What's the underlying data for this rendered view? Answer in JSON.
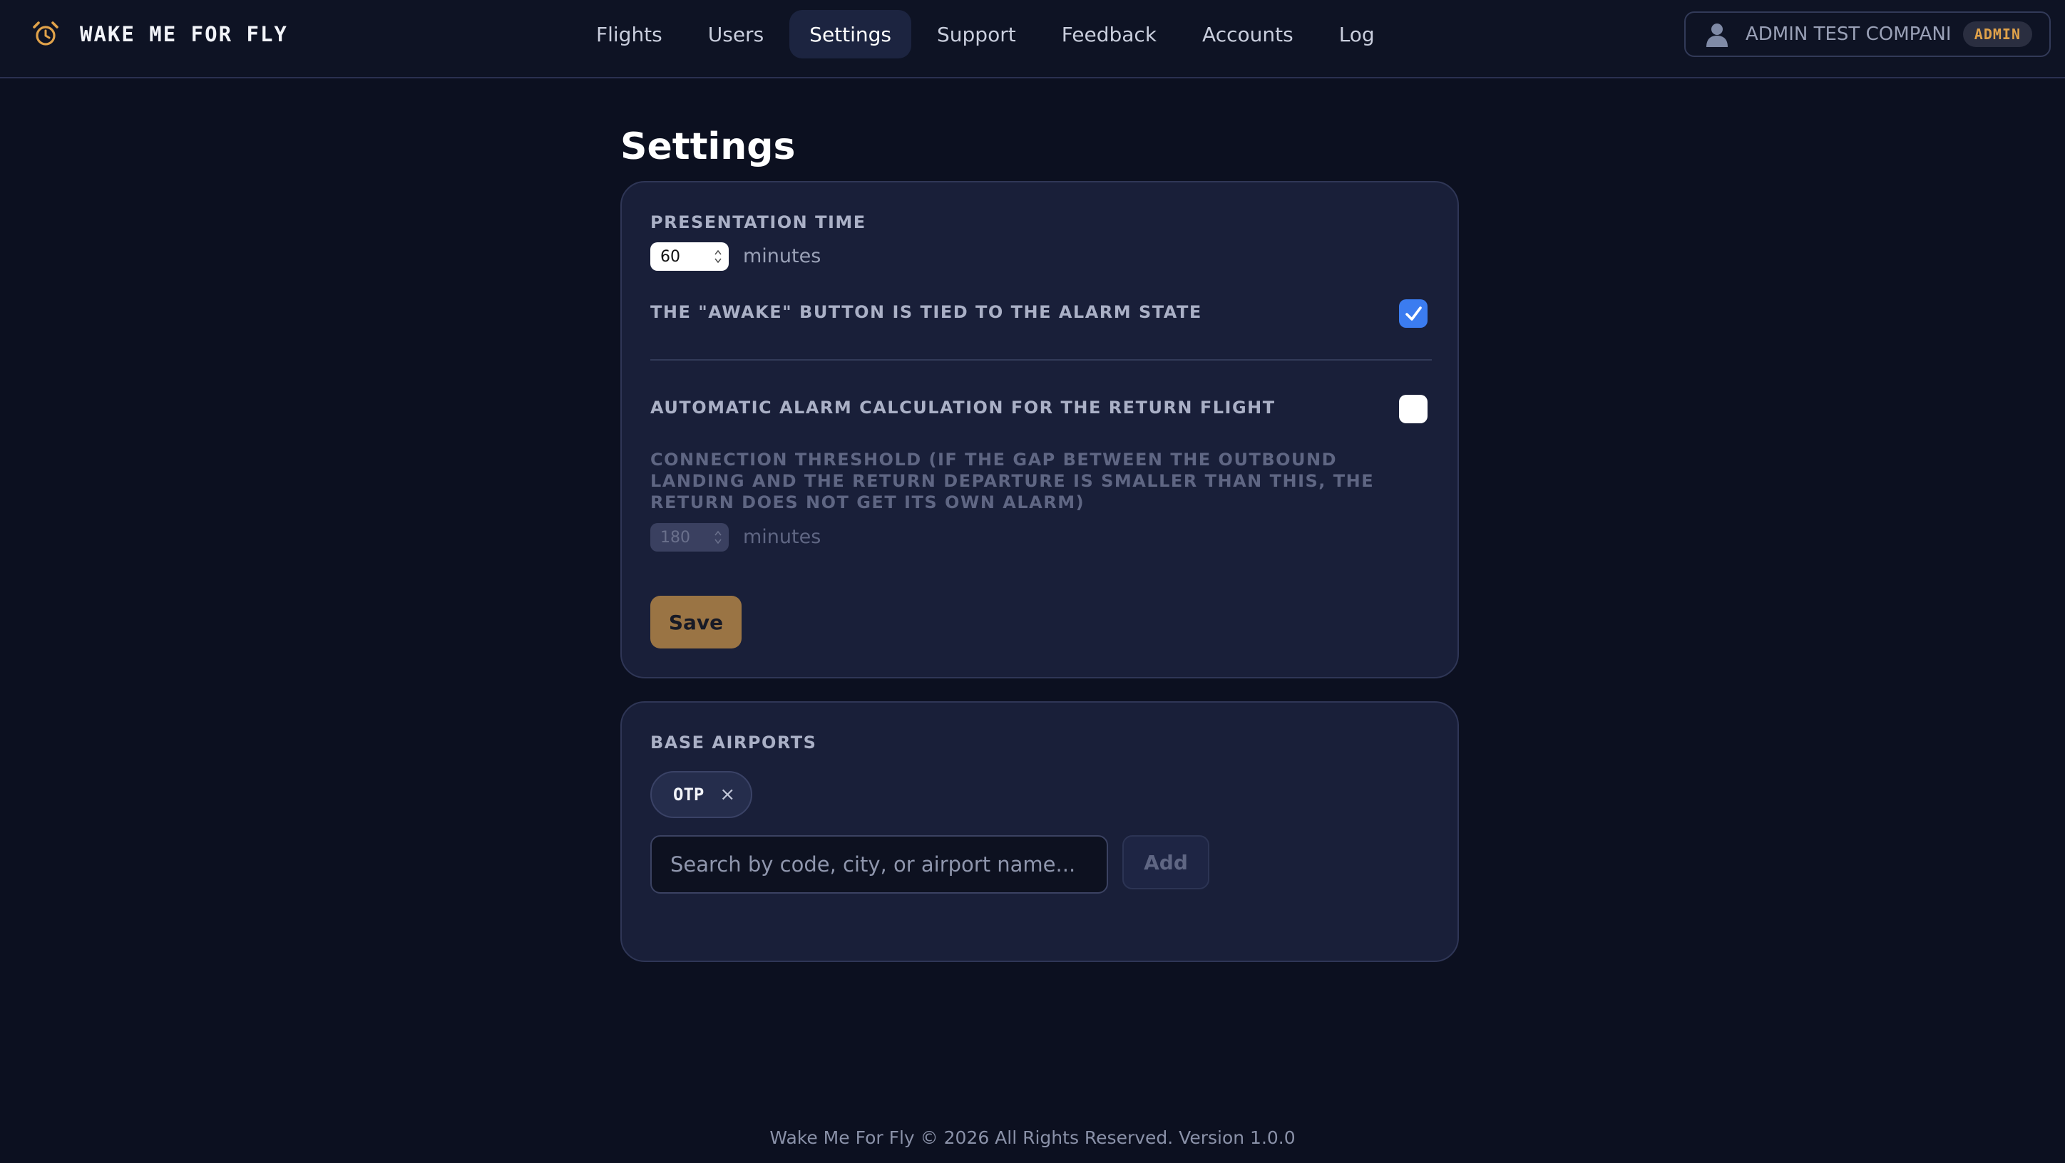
{
  "app": {
    "brand_name": "WAKE ME FOR FLY",
    "brand_icon": "alarm-clock-icon",
    "accent_color": "#e0a24a"
  },
  "nav": {
    "items": [
      {
        "label": "Flights",
        "active": false
      },
      {
        "label": "Users",
        "active": false
      },
      {
        "label": "Settings",
        "active": true
      },
      {
        "label": "Support",
        "active": false
      },
      {
        "label": "Feedback",
        "active": false
      },
      {
        "label": "Accounts",
        "active": false
      },
      {
        "label": "Log",
        "active": false
      }
    ]
  },
  "user": {
    "icon": "user-icon",
    "name": "ADMIN TEST COMPANI",
    "role": "ADMIN"
  },
  "page": {
    "title": "Settings"
  },
  "settings": {
    "presentation_time_label": "PRESENTATION TIME",
    "presentation_time_value": "60",
    "presentation_time_unit": "minutes",
    "awake_tied_label": "THE \"AWAKE\" BUTTON IS TIED TO THE ALARM STATE",
    "awake_tied_checked": true,
    "auto_return_label": "AUTOMATIC ALARM CALCULATION FOR THE RETURN FLIGHT",
    "auto_return_checked": false,
    "threshold_label": "CONNECTION THRESHOLD (IF THE GAP BETWEEN THE OUTBOUND LANDING AND THE RETURN DEPARTURE IS SMALLER THAN THIS, THE RETURN DOES NOT GET ITS OWN ALARM)",
    "threshold_value": "180",
    "threshold_unit": "minutes",
    "threshold_disabled": true,
    "save_label": "Save",
    "save_color": "#9a7444",
    "checkbox_color": "#3b7cf0"
  },
  "airports": {
    "label": "BASE AIRPORTS",
    "items": [
      {
        "code": "OTP",
        "remove_symbol": "×"
      }
    ],
    "search_placeholder": "Search by code, city, or airport name...",
    "search_value": "",
    "add_label": "Add"
  },
  "footer": {
    "text": "Wake Me For Fly © 2026 All Rights Reserved. Version 1.0.0"
  }
}
